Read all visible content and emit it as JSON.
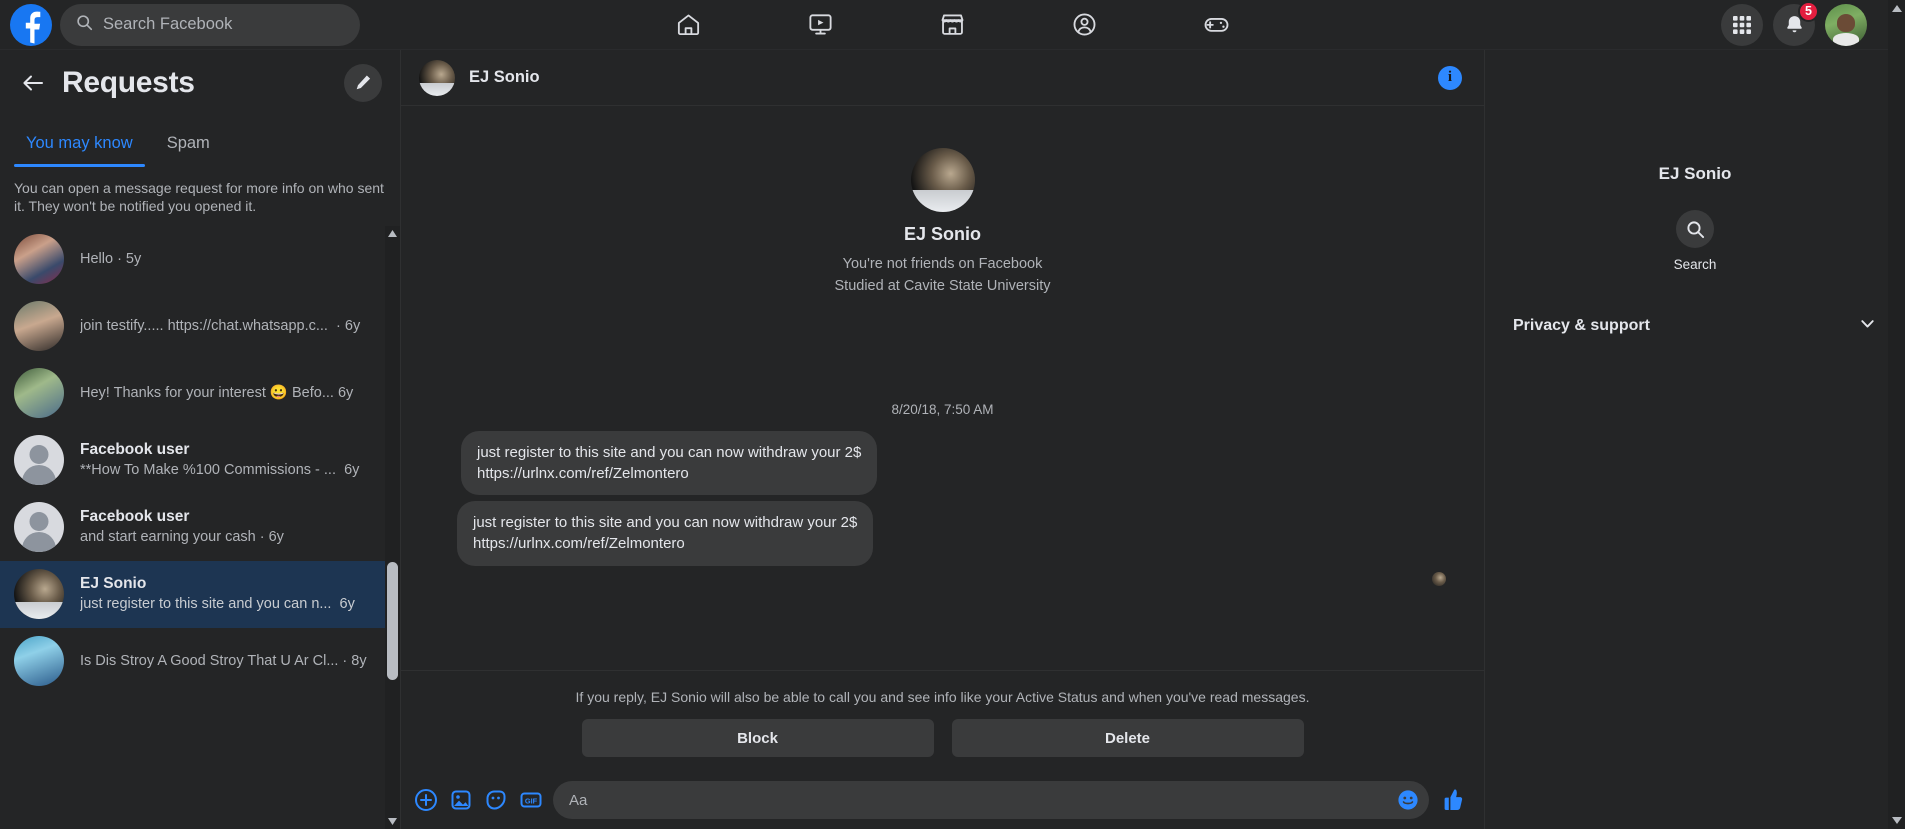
{
  "topbar": {
    "search": {
      "placeholder": "Search Facebook",
      "icon": "search-icon"
    },
    "logo": "facebook-logo",
    "nav": [
      {
        "name": "home-icon",
        "label": "Home"
      },
      {
        "name": "video-icon",
        "label": "Watch"
      },
      {
        "name": "marketplace-icon",
        "label": "Marketplace"
      },
      {
        "name": "groups-icon",
        "label": "Groups"
      },
      {
        "name": "gaming-icon",
        "label": "Gaming"
      }
    ],
    "menu_icon": "grid-menu-icon",
    "notifications_icon": "bell-icon",
    "notifications_count": "5",
    "profile_icon": "profile-avatar"
  },
  "left": {
    "title": "Requests",
    "back_icon": "back-arrow-icon",
    "compose_icon": "pencil-icon",
    "tabs": [
      {
        "label": "You may know",
        "active": true
      },
      {
        "label": "Spam",
        "active": false
      }
    ],
    "note": "You can open a message request for more info on who sent it. They won't be notified you opened it.",
    "conversations": [
      {
        "name": "",
        "preview": "Hello · 5y",
        "time": "",
        "avatar": "photo-avatar",
        "selected": false
      },
      {
        "name": "",
        "preview": "join testify..... https://chat.whatsapp.c...",
        "time": "6y",
        "avatar": "photo-avatar",
        "selected": false
      },
      {
        "name": "",
        "preview": "Hey! Thanks for your interest 😀 Befo...",
        "time": "6y",
        "avatar": "photo-avatar",
        "selected": false
      },
      {
        "name": "Facebook user",
        "preview": "**How To Make %100 Commissions - ...",
        "time": "6y",
        "avatar": "default-avatar",
        "selected": false
      },
      {
        "name": "Facebook user",
        "preview": "and start earning your cash · 6y",
        "time": "",
        "avatar": "default-avatar",
        "selected": false
      },
      {
        "name": "EJ Sonio",
        "preview": "just register to this site and you can n...",
        "time": "6y",
        "avatar": "cat-avatar",
        "selected": true
      },
      {
        "name": "",
        "preview": "Is Dis Stroy A Good Stroy That U Ar Cl... · 8y",
        "time": "",
        "avatar": "photo-avatar",
        "selected": false
      }
    ]
  },
  "chat": {
    "header": {
      "name": "EJ Sonio",
      "info_icon": "info-icon"
    },
    "intro": {
      "name": "EJ Sonio",
      "line1": "You're not friends on Facebook",
      "line2": "Studied at Cavite State University"
    },
    "timestamp": "8/20/18, 7:50 AM",
    "messages": [
      {
        "text": "just register to this site and you can now withdraw your 2$\nhttps://urlnx.com/ref/Zelmontero",
        "show_avatar": false
      },
      {
        "text": "just register to this site and you can now withdraw your 2$\nhttps://urlnx.com/ref/Zelmontero",
        "show_avatar": true
      }
    ],
    "reply_note": "If you reply, EJ Sonio will also be able to call you and see info like your Active Status and when you've read messages.",
    "block_label": "Block",
    "delete_label": "Delete",
    "composer": {
      "placeholder": "Aa",
      "icons": [
        "plus-icon",
        "image-icon",
        "sticker-icon",
        "gif-icon"
      ],
      "emoji_icon": "emoji-icon",
      "like_icon": "thumbs-up-icon"
    }
  },
  "right": {
    "name": "EJ Sonio",
    "search_label": "Search",
    "search_icon": "search-icon",
    "section_label": "Privacy & support",
    "chevron_icon": "chevron-down-icon"
  },
  "colors": {
    "accent": "#2d88ff",
    "brand": "#1877f2",
    "badge": "#e41e3f",
    "panel": "#242526",
    "bubble": "#3a3b3c",
    "selected_row": "#1d3552"
  }
}
